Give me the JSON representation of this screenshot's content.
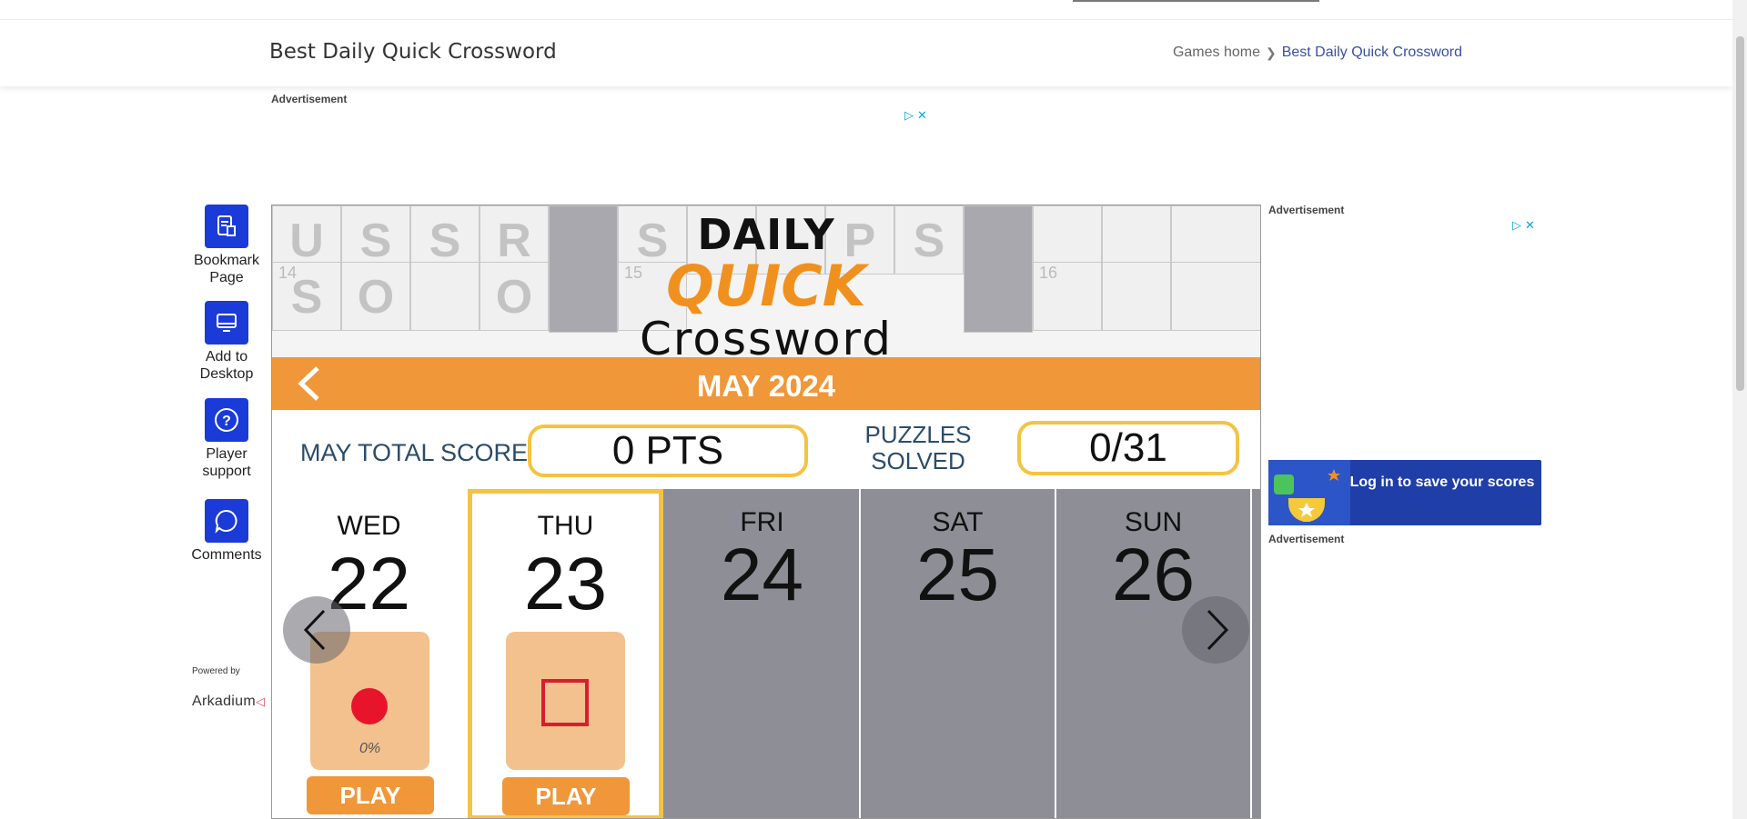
{
  "header": {
    "title": "Best Daily Quick Crossword",
    "breadcrumbs": {
      "home": "Games home",
      "current": "Best Daily Quick Crossword"
    }
  },
  "ads": {
    "label": "Advertisement"
  },
  "sidebar": {
    "items": [
      {
        "label": "Bookmark Page",
        "icon": "bookmark-page-icon"
      },
      {
        "label": "Add to Desktop",
        "icon": "desktop-icon"
      },
      {
        "label": "Player support",
        "icon": "question-icon"
      },
      {
        "label": "Comments",
        "icon": "chat-icon"
      }
    ],
    "powered_by": "Powered by",
    "brand": "Arkadium"
  },
  "game": {
    "logo": {
      "line1": "DAILY",
      "line2": "QUICK",
      "line3": "Crossword"
    },
    "banner_cells": {
      "row1": [
        "U",
        "S",
        "S",
        "R",
        "",
        "S",
        "",
        "",
        "P",
        "S",
        "",
        "",
        "",
        ""
      ],
      "row2": [
        "S",
        "O",
        "",
        "O",
        "",
        "",
        "",
        "",
        "",
        "",
        "",
        "",
        "",
        ""
      ],
      "numbers": {
        "row2_first": "14",
        "row2_mid": "15",
        "row2_right": "16"
      }
    },
    "month_label": "MAY 2024",
    "score_label": "MAY TOTAL SCORE",
    "score_value": "0 PTS",
    "solved_label": "PUZZLES SOLVED",
    "solved_value": "0/31",
    "days": [
      {
        "dow": "WED",
        "num": "22",
        "status": "in-progress",
        "percent": "0%",
        "play": "PLAY"
      },
      {
        "dow": "THU",
        "num": "23",
        "status": "not-started",
        "play": "PLAY"
      },
      {
        "dow": "FRI",
        "num": "24",
        "status": "locked"
      },
      {
        "dow": "SAT",
        "num": "25",
        "status": "locked"
      },
      {
        "dow": "SUN",
        "num": "26",
        "status": "locked"
      }
    ],
    "colors": {
      "accent": "#f0973a",
      "highlight": "#f5c342",
      "locked": "#8e8e96"
    }
  },
  "login": {
    "text": "Log in to save your scores"
  }
}
